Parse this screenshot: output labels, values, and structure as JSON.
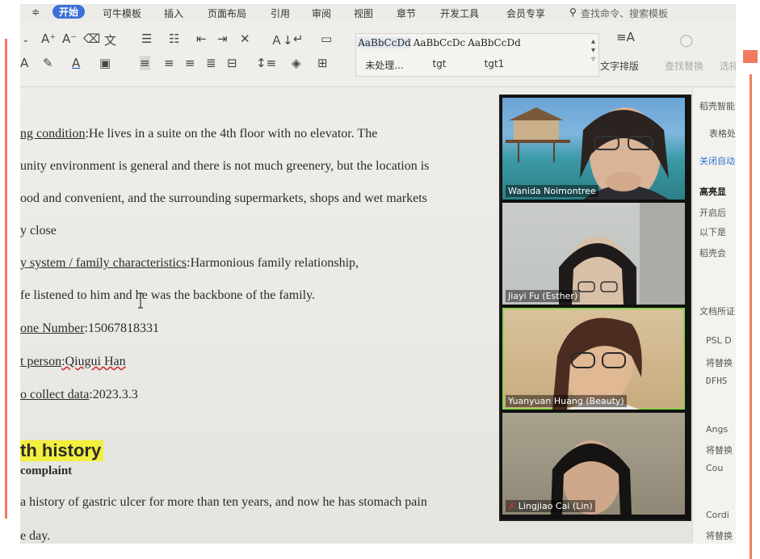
{
  "menu": {
    "items": [
      "≑",
      "开始",
      "可牛模板",
      "插入",
      "页面布局",
      "引用",
      "审阅",
      "视图",
      "章节",
      "开发工具",
      "会员专享"
    ],
    "search_placeholder": "查找命令、搜索模板"
  },
  "ribbon": {
    "style_previews": [
      "AaBbCcDd",
      "AaBbCcDc",
      "AaBbCcDd"
    ],
    "style_names": [
      "未处理...",
      "tgt",
      "tgt1"
    ],
    "layout_label": "文字排版",
    "find_label": "查找替换",
    "select_label": "选择"
  },
  "document": {
    "lines": [
      {
        "label": "ng condition",
        "text": ":He lives in a suite on the 4th floor with no elevator. The"
      },
      {
        "label": "",
        "text": "unity environment is general and there is not much greenery, but the location is"
      },
      {
        "label": "",
        "text": "ood and convenient, and the surrounding supermarkets, shops and wet markets"
      },
      {
        "label": "",
        "text": "y close"
      },
      {
        "label": "y system / family characteristics",
        "text": ":Harmonious family relationship,"
      },
      {
        "label": "",
        "text": "fe listened to him and he was the backbone of the family."
      },
      {
        "label": "one Number",
        "text": ":15067818331"
      },
      {
        "label": "t person",
        "text": ":Qiugui Han"
      },
      {
        "label": "o collect data",
        "text": ":2023.3.3"
      }
    ],
    "heading": "th history",
    "subheading": "complaint",
    "body_lines": [
      "a history of gastric ulcer for more than ten years, and now he has stomach pain",
      "e day."
    ]
  },
  "participants": [
    {
      "name": "Wanida Noimontree"
    },
    {
      "name": "Jiayi Fu (Esther)"
    },
    {
      "name": "Yuanyuan Huang (Beauty)"
    },
    {
      "name": "Lingjiao Cai (Lin)"
    }
  ],
  "side_panel": {
    "items": [
      "稻壳智能",
      "表格处",
      "关闭自动",
      "高亮显",
      "开启后",
      "以下是",
      "稻壳会",
      "文档所证",
      "PSL D",
      "将替换",
      "DFHS",
      "Angs",
      "将替换",
      "Cou",
      "Cordi",
      "将替换"
    ]
  }
}
